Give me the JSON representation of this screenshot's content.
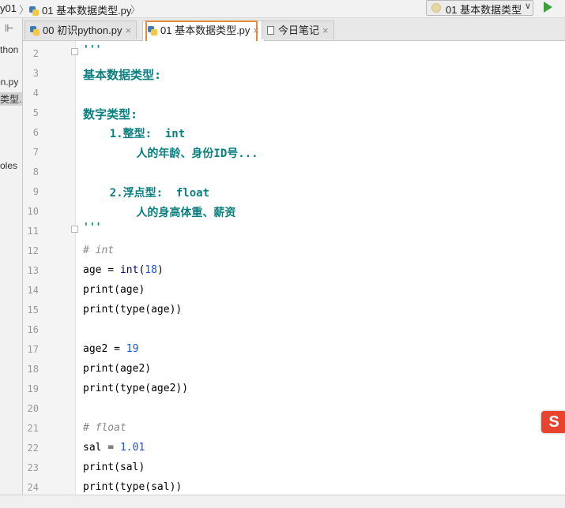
{
  "navbar": {
    "project_crumb": "y01",
    "file_crumb": "01 基本数据类型.py",
    "run_config_label": "01 基本数据类型"
  },
  "project_panel": {
    "items": [
      "ython",
      "on.py",
      "类型.",
      "soles"
    ]
  },
  "tabs": [
    {
      "label": "00 初识python.py",
      "active": false
    },
    {
      "label": "01 基本数据类型.py",
      "active": true
    },
    {
      "label": "今日笔记",
      "active": false
    }
  ],
  "editor": {
    "lines": [
      {
        "n": "2",
        "text": "'''"
      },
      {
        "n": "3",
        "text": "基本数据类型:"
      },
      {
        "n": "4",
        "text": ""
      },
      {
        "n": "5",
        "text": "数字类型:"
      },
      {
        "n": "6",
        "text": "    1.整型:  int"
      },
      {
        "n": "7",
        "text": "        人的年龄、身份ID号..."
      },
      {
        "n": "8",
        "text": ""
      },
      {
        "n": "9",
        "text": "    2.浮点型:  float"
      },
      {
        "n": "10",
        "text": "        人的身高体重、薪资"
      },
      {
        "n": "11",
        "text": "'''"
      },
      {
        "n": "12",
        "text": "# int"
      },
      {
        "n": "13",
        "text": "age = int(18)"
      },
      {
        "n": "14",
        "text": "print(age)"
      },
      {
        "n": "15",
        "text": "print(type(age))"
      },
      {
        "n": "16",
        "text": ""
      },
      {
        "n": "17",
        "text": "age2 = 19"
      },
      {
        "n": "18",
        "text": "print(age2)"
      },
      {
        "n": "19",
        "text": "print(type(age2))"
      },
      {
        "n": "20",
        "text": ""
      },
      {
        "n": "21",
        "text": "# float"
      },
      {
        "n": "22",
        "text": "sal = 1.01"
      },
      {
        "n": "23",
        "text": "print(sal)"
      },
      {
        "n": "24",
        "text": "print(type(sal))"
      }
    ]
  },
  "ime": {
    "glyph": "S"
  },
  "colors": {
    "docstring": "#0a7f7f",
    "comment": "#888888",
    "number": "#1750eb",
    "highlight_border": "#e48a3c"
  }
}
